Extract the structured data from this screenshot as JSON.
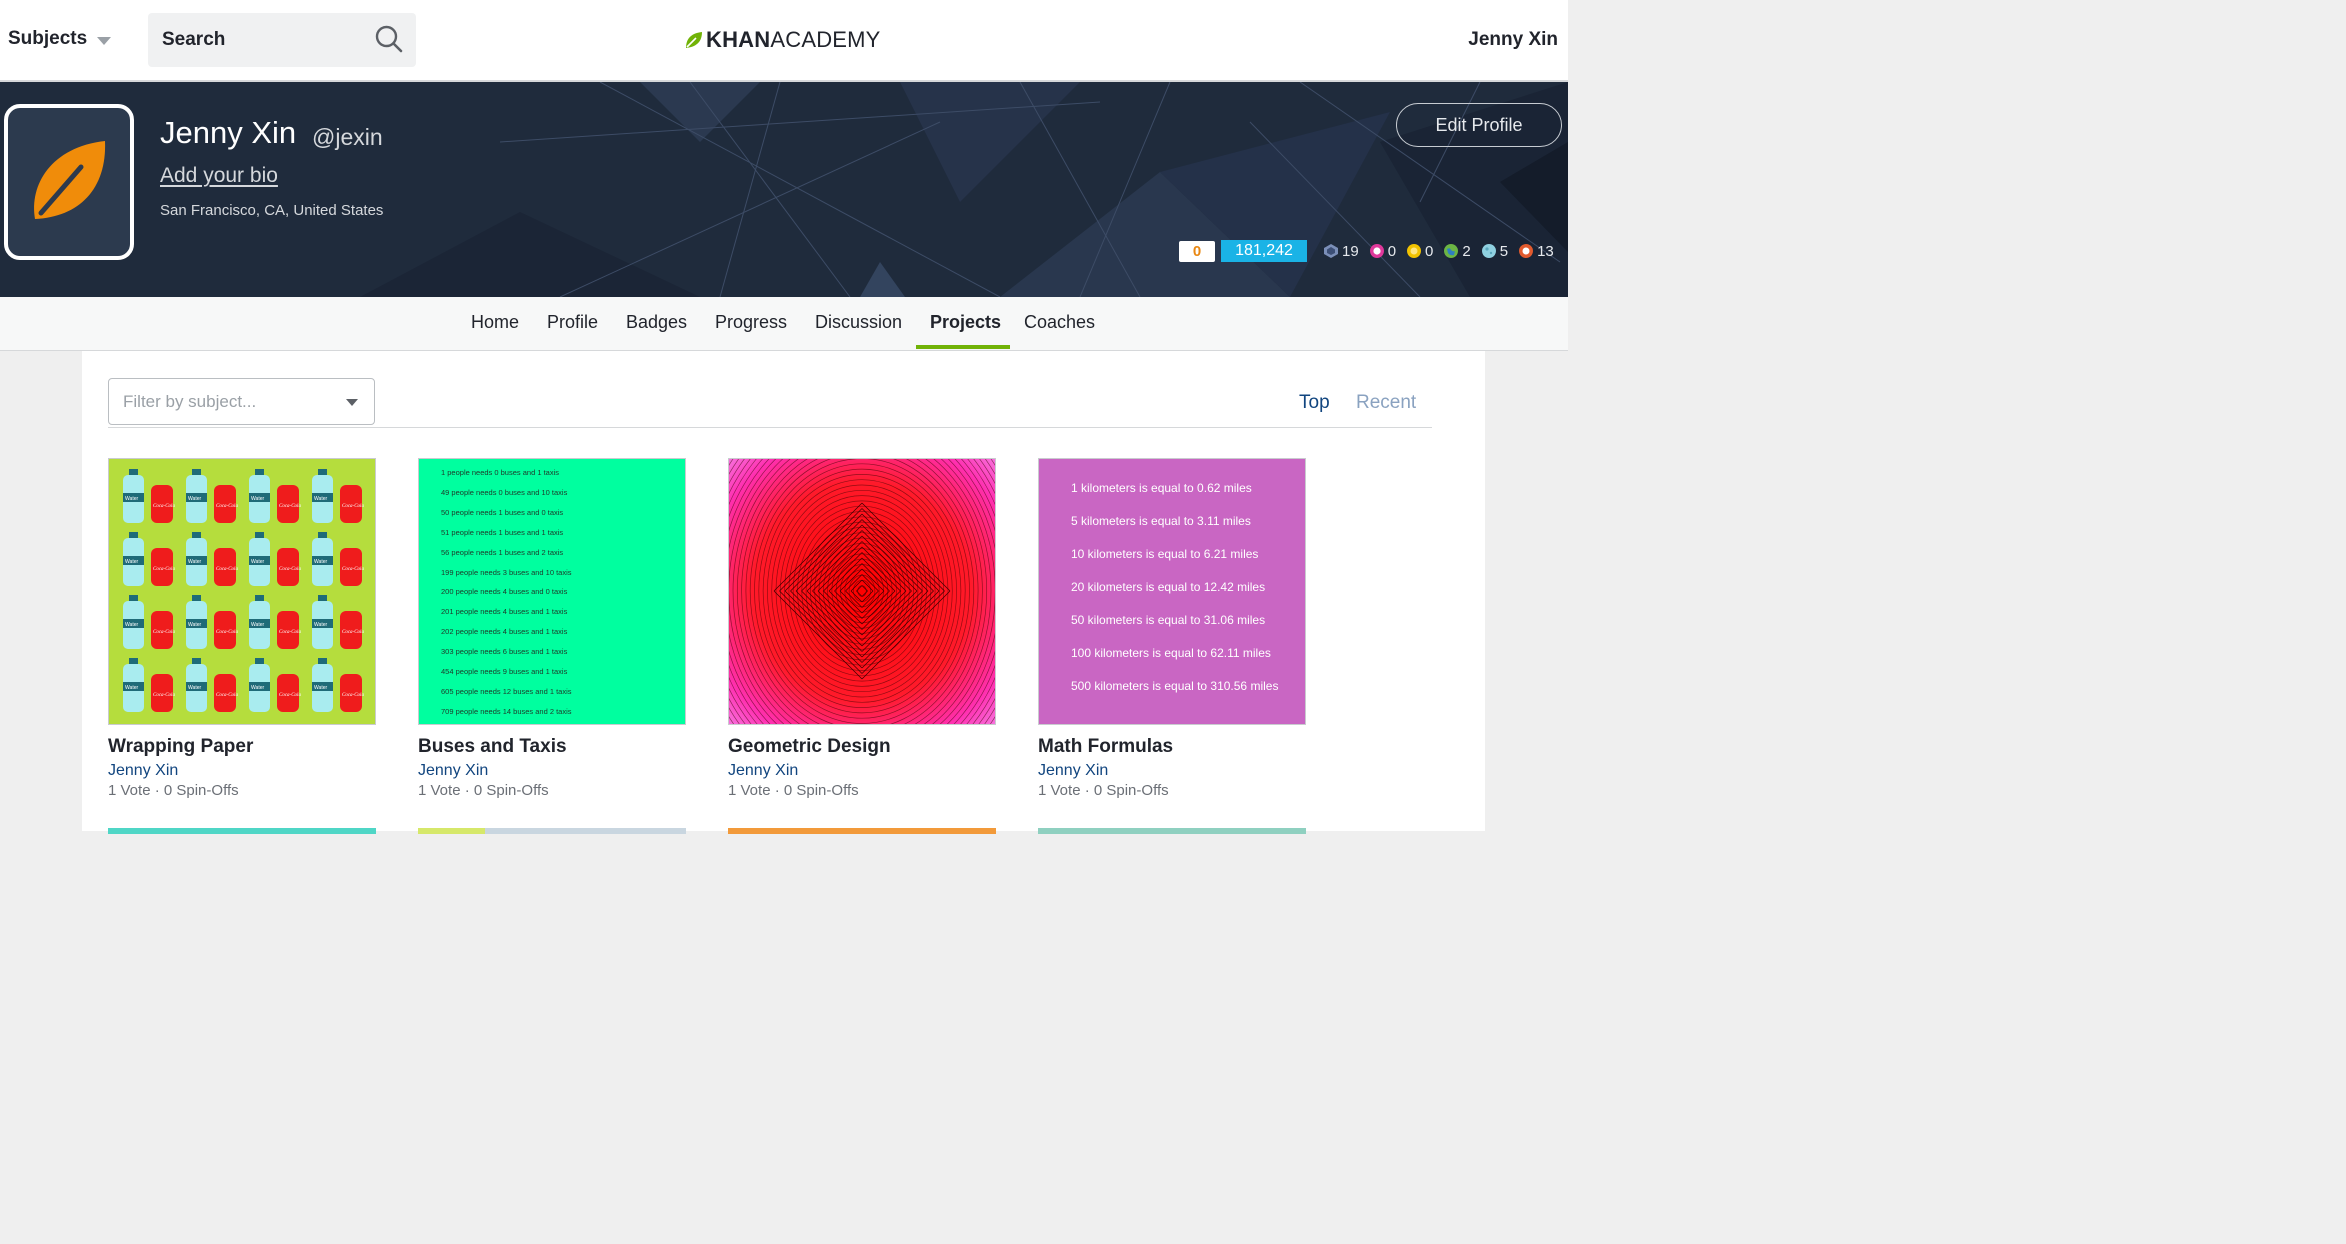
{
  "topnav": {
    "subjects_label": "Subjects",
    "search_label": "Search",
    "logo_bold": "KHAN",
    "logo_light": "ACADEMY",
    "user_name": "Jenny Xin"
  },
  "profile": {
    "name": "Jenny Xin",
    "handle": "@jexin",
    "add_bio": "Add your bio",
    "location": "San Francisco, CA, United States",
    "edit_button": "Edit Profile",
    "streak": "0",
    "points": "181,242",
    "badges": [
      {
        "icon": "challenge-patch-icon",
        "color": "#7b8fb8",
        "count": "19"
      },
      {
        "icon": "black-hole-badge-icon",
        "color": "#e0389b",
        "count": "0"
      },
      {
        "icon": "sun-badge-icon",
        "color": "#f2c300",
        "count": "0"
      },
      {
        "icon": "earth-badge-icon",
        "color": "#6cb544",
        "count": "2"
      },
      {
        "icon": "moon-badge-icon",
        "color": "#8fd0e0",
        "count": "5"
      },
      {
        "icon": "meteorite-badge-icon",
        "color": "#e15a2e",
        "count": "13"
      }
    ]
  },
  "tabs": [
    "Home",
    "Profile",
    "Badges",
    "Progress",
    "Discussion",
    "Projects",
    "Coaches"
  ],
  "active_tab": "Projects",
  "filter": {
    "placeholder": "Filter by subject..."
  },
  "sort": {
    "top": "Top",
    "recent": "Recent"
  },
  "projects": [
    {
      "title": "Wrapping Paper",
      "author": "Jenny Xin",
      "meta": "1 Vote · 0 Spin-Offs",
      "bg": "#b5dd3d"
    },
    {
      "title": "Buses and Taxis",
      "author": "Jenny Xin",
      "meta": "1 Vote · 0 Spin-Offs",
      "bg": "#00ff9f"
    },
    {
      "title": "Geometric Design",
      "author": "Jenny Xin",
      "meta": "1 Vote · 0 Spin-Offs",
      "bg": "#ff0000"
    },
    {
      "title": "Math Formulas",
      "author": "Jenny Xin",
      "meta": "1 Vote · 0 Spin-Offs",
      "bg": "#c966c3"
    }
  ],
  "buses_lines": [
    "1 people needs 0 buses and 1 taxis",
    "49 people needs 0 buses and 10 taxis",
    "50 people needs 1 buses and 0 taxis",
    "51 people needs 1 buses and 1 taxis",
    "56 people needs 1 buses and 2 taxis",
    "199 people needs 3 buses and 10 taxis",
    "200 people needs 4 buses and 0 taxis",
    "201 people needs 4 buses and 1 taxis",
    "202 people needs 4 buses and 1 taxis",
    "303 people needs 6 buses and 1 taxis",
    "454 people needs 9 buses and 1 taxis",
    "605 people needs 12 buses and 1 taxis",
    "709 people needs 14 buses and 2 taxis"
  ],
  "math_lines": [
    "1 kilometers is equal to 0.62 miles",
    "5 kilometers is equal to 3.11 miles",
    "10 kilometers is equal to 6.21 miles",
    "20 kilometers is equal to 12.42 miles",
    "50 kilometers is equal to 31.06 miles",
    "100 kilometers is equal to 62.11 miles",
    "500 kilometers is equal to 310.56 miles"
  ],
  "wrapping_labels": {
    "bottle": "Water",
    "can": "Coca-Cola"
  }
}
